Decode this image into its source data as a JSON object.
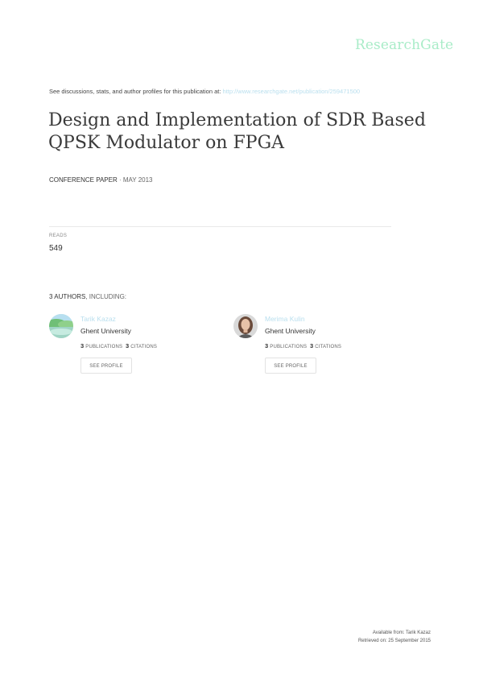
{
  "brand": {
    "name": "ResearchGate"
  },
  "discussion": {
    "text": "See discussions, stats, and author profiles for this publication at: ",
    "url": "http://www.researchgate.net/publication/259471500"
  },
  "paper": {
    "title": "Design and Implementation of SDR Based QPSK Modulator on FPGA",
    "type": "CONFERENCE PAPER",
    "separator": " · ",
    "date": "MAY 2013"
  },
  "stats": {
    "reads_label": "READS",
    "reads_value": "549"
  },
  "authors_heading": {
    "count": "3 AUTHORS",
    "suffix": ", INCLUDING:"
  },
  "authors": [
    {
      "name": "Tarik Kazaz",
      "institution": "Ghent University",
      "publications_count": "3",
      "publications_label": "PUBLICATIONS",
      "citations_count": "3",
      "citations_label": "CITATIONS",
      "button_label": "SEE PROFILE"
    },
    {
      "name": "Merima Kulin",
      "institution": "Ghent University",
      "publications_count": "3",
      "publications_label": "PUBLICATIONS",
      "citations_count": "3",
      "citations_label": "CITATIONS",
      "button_label": "SEE PROFILE"
    }
  ],
  "footer": {
    "available_from": "Available from: Tarik Kazaz",
    "retrieved_on": "Retrieved on: 25 September 2015"
  },
  "colors": {
    "brand": "#a9ecc8",
    "link": "#b9dfee",
    "text": "#333333"
  }
}
